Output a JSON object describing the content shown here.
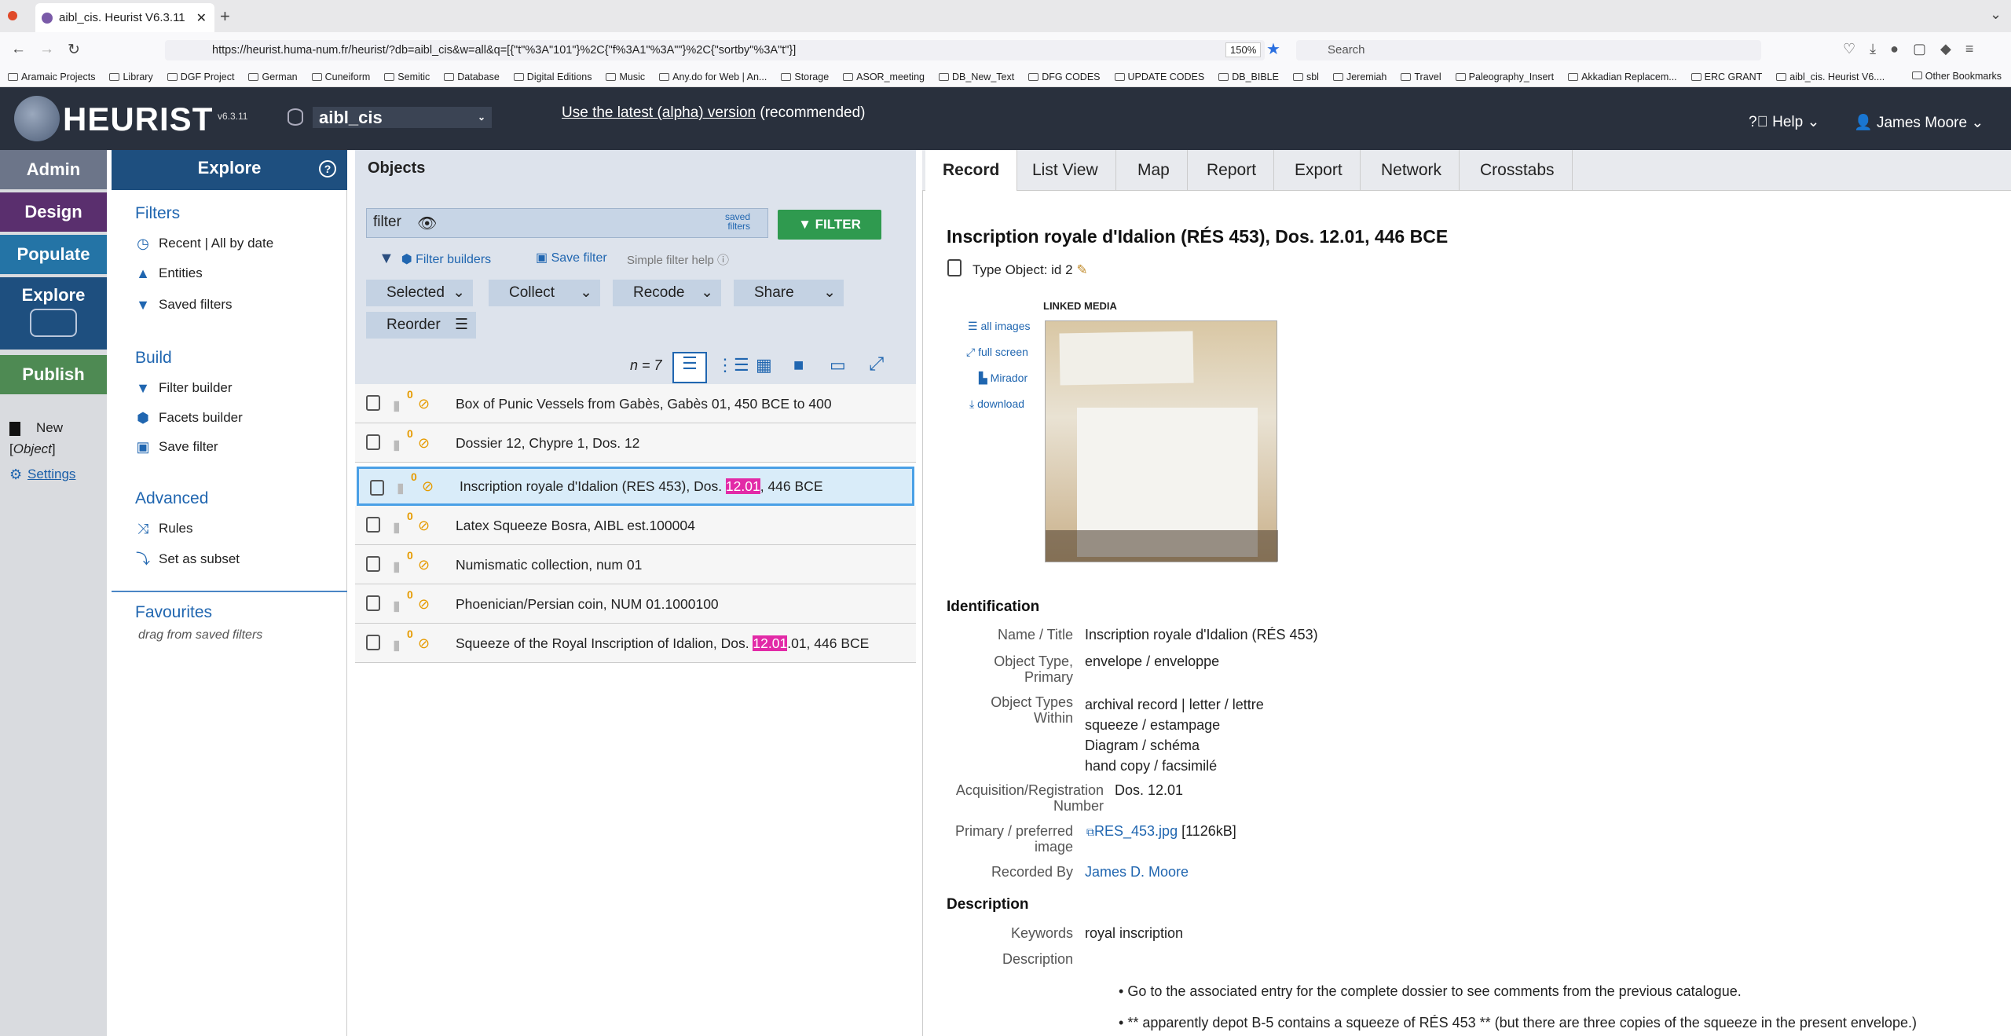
{
  "browser": {
    "tab_title": "aibl_cis. Heurist V6.3.11",
    "url": "https://heurist.huma-num.fr/heurist/?db=aibl_cis&w=all&q=[{\"t\"%3A\"101\"}%2C{\"f%3A1\"%3A\"\"}%2C{\"sortby\"%3A\"t\"}]",
    "zoom": "150%",
    "search_placeholder": "Search",
    "bookmarks": [
      "Aramaic Projects",
      "Library",
      "DGF Project",
      "German",
      "Cuneiform",
      "Semitic",
      "Database",
      "Digital Editions",
      "Music",
      "Any.do for Web | An...",
      "Storage",
      "ASOR_meeting",
      "DB_New_Text",
      "DFG CODES",
      "UPDATE CODES",
      "DB_BIBLE",
      "sbl",
      "Jeremiah",
      "Travel",
      "Paleography_Insert",
      "Akkadian Replacem...",
      "ERC GRANT",
      "aibl_cis. Heurist V6...."
    ],
    "other_bookmarks": "Other Bookmarks"
  },
  "header": {
    "brand": "HEURIST",
    "version": "v6.3.11",
    "db": "aibl_cis",
    "latest_link": "Use the latest (alpha) version",
    "latest_suffix": " (recommended)",
    "help": "Help",
    "user": "James Moore"
  },
  "nav": {
    "admin": "Admin",
    "design": "Design",
    "populate": "Populate",
    "explore": "Explore",
    "publish": "Publish",
    "new": "New",
    "new_type": "Object",
    "settings": "Settings"
  },
  "explore": {
    "title": "Explore",
    "filters_head": "Filters",
    "recent": "Recent | All by date",
    "entities": "Entities",
    "saved_filters": "Saved filters",
    "build_head": "Build",
    "filter_builder": "Filter builder",
    "facets_builder": "Facets builder",
    "save_filter": "Save filter",
    "advanced_head": "Advanced",
    "rules": "Rules",
    "set_subset": "Set as subset",
    "favourites_head": "Favourites",
    "favourites_hint": "drag from saved filters"
  },
  "objects": {
    "title": "Objects",
    "filter_value": "filter",
    "saved_filters": "saved filters",
    "filter_btn": "FILTER",
    "filter_builders": "Filter builders",
    "save_filter": "Save filter",
    "simple_help": "Simple filter help",
    "menus": [
      "Selected",
      "Collect",
      "Recode",
      "Share"
    ],
    "reorder": "Reorder",
    "count": "n = 7",
    "rows": [
      {
        "pre": "Box of Punic Vessels from Gabès, Gabès 01, 450 BCE to 400",
        "hl": "",
        "post": "",
        "n": "0"
      },
      {
        "pre": "Dossier 12, Chypre 1, Dos. 12",
        "hl": "",
        "post": "",
        "n": "0"
      },
      {
        "pre": "Inscription royale d'Idalion (RES 453), Dos. ",
        "hl": "12.01",
        "post": ", 446 BCE",
        "n": "0"
      },
      {
        "pre": "Latex Squeeze Bosra, AIBL est.100004",
        "hl": "",
        "post": "",
        "n": "0"
      },
      {
        "pre": "Numismatic collection, num 01",
        "hl": "",
        "post": "",
        "n": "0"
      },
      {
        "pre": "Phoenician/Persian coin, NUM 01.1000100",
        "hl": "",
        "post": "",
        "n": "0"
      },
      {
        "pre": "Squeeze of the Royal Inscription of Idalion, Dos. ",
        "hl": "12.01",
        "post": ".01, 446 BCE",
        "n": "0"
      }
    ]
  },
  "record": {
    "tabs": [
      "Record",
      "List View",
      "Map",
      "Report",
      "Export",
      "Network",
      "Crosstabs"
    ],
    "title": "Inscription royale d'Idalion (RÉS 453), Dos. 12.01, 446 BCE",
    "type": "Type Object: id 2",
    "linked_media": "LINKED MEDIA",
    "media_links": [
      "all images",
      "full screen",
      "Mirador",
      "download"
    ],
    "ident_head": "Identification",
    "name_lbl": "Name / Title",
    "name_val": "Inscription royale d'Idalion (RÉS 453)",
    "otype_lbl1": "Object Type,",
    "otype_lbl2": "Primary",
    "otype_val": "envelope / enveloppe",
    "within_lbl1": "Object Types",
    "within_lbl2": "Within",
    "within_vals": [
      "archival record | letter / lettre",
      "squeeze / estampage",
      "Diagram / schéma",
      "hand copy / facsimilé"
    ],
    "acq_lbl1": "Acquisition/Registration",
    "acq_lbl2": "Number",
    "acq_val": "Dos. 12.01",
    "img_lbl1": "Primary / preferred",
    "img_lbl2": "image",
    "img_link": "RES_453.jpg",
    "img_size": "[1126kB]",
    "rec_lbl": "Recorded By",
    "rec_val": "James D. Moore",
    "desc_head": "Description",
    "kw_lbl": "Keywords",
    "kw_val": "royal inscription",
    "desc_lbl": "Description",
    "bullets": [
      "Go to the associated entry for the complete dossier to see comments from the previous catalogue.",
      "** apparently depot B-5 contains a squeeze of RÉS 453 ** (but there are three copies of the squeeze in the present envelope.)"
    ]
  }
}
